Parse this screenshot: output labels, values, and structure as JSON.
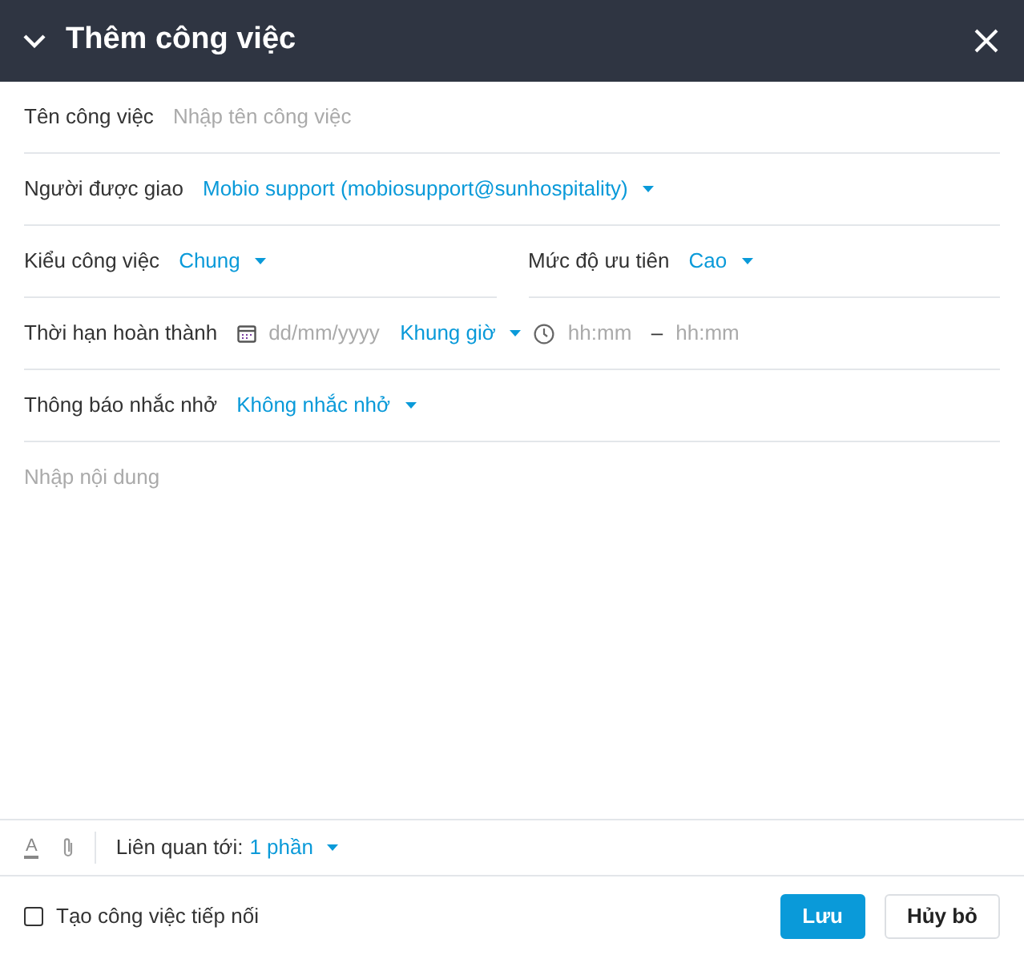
{
  "header": {
    "title": "Thêm công việc"
  },
  "task_name": {
    "label": "Tên công việc",
    "placeholder": "Nhập tên công việc"
  },
  "assignee": {
    "label": "Người được giao",
    "value": "Mobio support (mobiosupport@sunhospitality)"
  },
  "task_type": {
    "label": "Kiểu công việc",
    "value": "Chung"
  },
  "priority": {
    "label": "Mức độ ưu tiên",
    "value": "Cao"
  },
  "deadline": {
    "label": "Thời hạn hoàn thành",
    "date_placeholder": "dd/mm/yyyy",
    "time_frame": "Khung giờ",
    "from_placeholder": "hh:mm",
    "separator": "–",
    "to_placeholder": "hh:mm"
  },
  "reminder": {
    "label": "Thông báo nhắc nhở",
    "value": "Không nhắc nhở"
  },
  "content": {
    "placeholder": "Nhập nội dung"
  },
  "toolbar": {
    "format_glyph": "A",
    "related_label": "Liên quan tới:",
    "related_value": "1 phần"
  },
  "footer": {
    "follow_up": {
      "label": "Tạo công việc tiếp nối",
      "checked": false
    },
    "buttons": [
      {
        "label": "Lưu",
        "kind": "primary"
      },
      {
        "label": "Hủy bỏ",
        "kind": "secondary"
      }
    ]
  }
}
